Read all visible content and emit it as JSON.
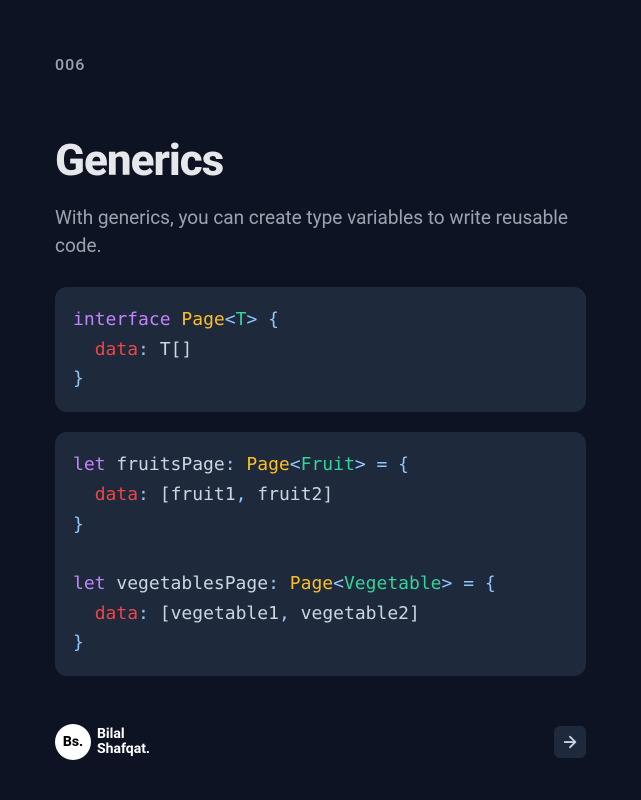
{
  "page_number": "006",
  "title": "Generics",
  "subtitle": "With generics, you can create type variables to write reusable code.",
  "code1": {
    "kw_interface": "interface",
    "type_page": "Page",
    "lt1": "<",
    "gen_t": "T",
    "gt1": ">",
    "brace_open": " {",
    "indent": "  ",
    "prop_data": "data",
    "colon": ": ",
    "ident_t": "T",
    "arr": "[]",
    "brace_close": "}"
  },
  "code2": {
    "kw_let1": "let",
    "ident_fruitsPage": " fruitsPage",
    "colon1": ": ",
    "type_page1": "Page",
    "lt1": "<",
    "gen_fruit": "Fruit",
    "gt1": ">",
    "eq1": " = {",
    "indent": "  ",
    "prop_data1": "data",
    "colon_d1": ": ",
    "arr_open1": "[",
    "ident_f1": "fruit1",
    "comma1": ", ",
    "ident_f2": "fruit2",
    "arr_close1": "]",
    "brace_close1": "}",
    "blank": "",
    "kw_let2": "let",
    "ident_vegPage": " vegetablesPage",
    "colon2": ": ",
    "type_page2": "Page",
    "lt2": "<",
    "gen_veg": "Vegetable",
    "gt2": ">",
    "eq2": " = {",
    "prop_data2": "data",
    "colon_d2": ": ",
    "arr_open2": "[",
    "ident_v1": "vegetable1",
    "comma2": ", ",
    "ident_v2": "vegetable2",
    "arr_close2": "]",
    "brace_close2": "}"
  },
  "footer": {
    "badge": "Bs.",
    "name_line1": "Bilal",
    "name_line2": "Shafqat."
  }
}
